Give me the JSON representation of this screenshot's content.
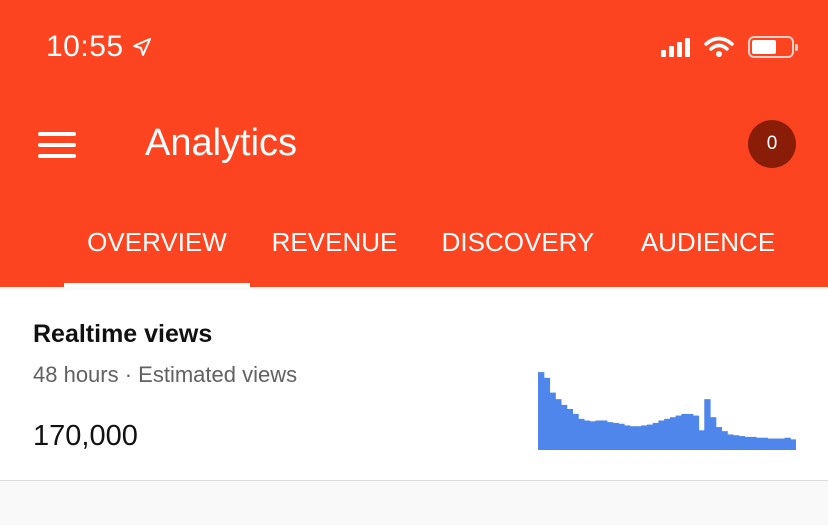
{
  "status": {
    "time": "10:55"
  },
  "header": {
    "title": "Analytics",
    "notification_count": "0"
  },
  "tabs": [
    {
      "label": "OVERVIEW",
      "active": true
    },
    {
      "label": "REVENUE"
    },
    {
      "label": "DISCOVERY"
    },
    {
      "label": "AUDIENCE"
    }
  ],
  "realtime": {
    "title": "Realtime views",
    "subtitle": "48 hours · Estimated views",
    "value": "170,000"
  },
  "colors": {
    "accent": "#fc4420",
    "chart": "#4f86ec",
    "badge": "#8a1d07"
  },
  "chart_data": {
    "type": "bar",
    "values": [
      95,
      88,
      70,
      62,
      55,
      50,
      44,
      38,
      36,
      35,
      36,
      36,
      34,
      33,
      32,
      30,
      29,
      29,
      30,
      31,
      33,
      36,
      38,
      40,
      42,
      44,
      44,
      42,
      24,
      62,
      40,
      28,
      23,
      19,
      18,
      17,
      16,
      16,
      15,
      15,
      14,
      14,
      14,
      15,
      13
    ]
  }
}
